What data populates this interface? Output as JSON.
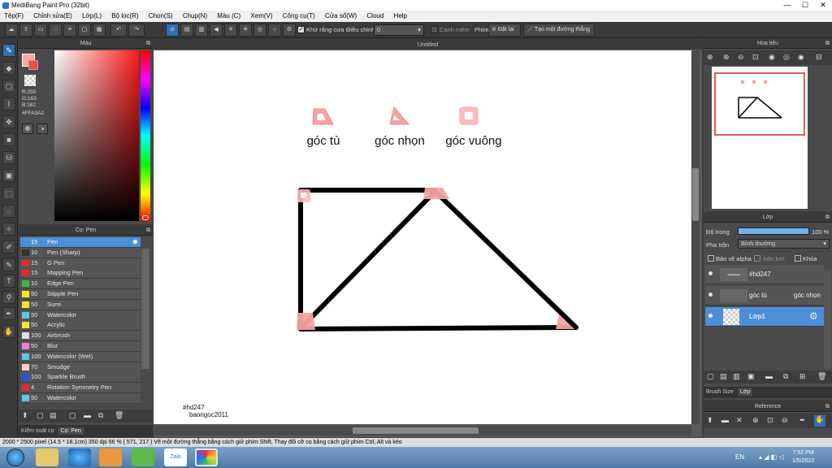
{
  "window": {
    "title": "MediBang Paint Pro (32bit)",
    "min": "—",
    "max": "☐",
    "close": "✕"
  },
  "menu": [
    "Tệp(F)",
    "Chỉnh sửa(E)",
    "Lớp(L)",
    "Bộ lọc(R)",
    "Chọn(S)",
    "Chụp(N)",
    "Màu (C)",
    "Xem(V)",
    "Công cụ(T)",
    "Cửa sổ(W)",
    "Cloud",
    "Help"
  ],
  "toolbar": {
    "antialias_label": "Khử răng cưa",
    "adjust_label": "Điều chỉnh",
    "adjust_value": "0",
    "sharp_label": "Cạnh mềm",
    "pen_label": "Phím",
    "reset_label": "Đặt lại",
    "create_line_label": "Tạo một đường thẳng"
  },
  "color_panel": {
    "title": "Màu",
    "r": "R:255",
    "g": "G:163",
    "b": "B:162",
    "hex": "#FFA3A2",
    "fg_color": "#ffa3a2"
  },
  "brush_panel": {
    "title": "Cọ: Pen",
    "items": [
      {
        "size": "15",
        "name": "Pen",
        "color": "#4a8fd8"
      },
      {
        "size": "10",
        "name": "Pen (Sharp)",
        "color": "#333333"
      },
      {
        "size": "15",
        "name": "G Pen",
        "color": "#e52b2b"
      },
      {
        "size": "15",
        "name": "Mapping Pen",
        "color": "#e52b2b"
      },
      {
        "size": "10",
        "name": "Edge Pen",
        "color": "#3cb83c"
      },
      {
        "size": "50",
        "name": "Stipple Pen",
        "color": "#f2e52b"
      },
      {
        "size": "50",
        "name": "Sumi",
        "color": "#f2e52b"
      },
      {
        "size": "50",
        "name": "Watercolor",
        "color": "#5bc8e8"
      },
      {
        "size": "50",
        "name": "Acrylic",
        "color": "#f2e52b"
      },
      {
        "size": "100",
        "name": "Airbrush",
        "color": "#dddddd"
      },
      {
        "size": "50",
        "name": "Blur",
        "color": "#f07ad7"
      },
      {
        "size": "100",
        "name": "Watercolor (Wet)",
        "color": "#5bc8e8"
      },
      {
        "size": "70",
        "name": "Smudge",
        "color": "#f5d6c0"
      },
      {
        "size": "100",
        "name": "Sparkle Brush",
        "color": "#2b4fe5"
      },
      {
        "size": "4",
        "name": "Rotation Symmetry Pen",
        "color": "#e52b2b"
      },
      {
        "size": "50",
        "name": "Watercolor",
        "color": "#5bc8e8"
      }
    ],
    "tab_control": "Kiểm soát cọ",
    "tab_pen": "Cọ: Pen"
  },
  "canvas": {
    "tab_title": "Untitled",
    "labels": [
      "góc tù",
      "góc nhọn",
      "góc vuông"
    ],
    "signature_1": "#hd247",
    "signature_2": "baongoc2011"
  },
  "navigator": {
    "title": "Hoa tiêu"
  },
  "layer_panel": {
    "title": "Lớp",
    "opacity_label": "Độ trong",
    "opacity_value": "100 %",
    "opacity": 1.0,
    "blend_label": "Pha trộn",
    "blend_value": "Bình thường",
    "protect_alpha": "Bảo vệ alpha",
    "clipping": "Xén bớt",
    "lock": "Khóa",
    "layers": [
      {
        "name": "#hd247",
        "extra": ""
      },
      {
        "name": "góc tù",
        "extra": "góc nhọn"
      },
      {
        "name": "Lớp1",
        "extra": ""
      }
    ],
    "tab_brush_size": "Brush Size",
    "tab_layer": "Lớp"
  },
  "reference": {
    "title": "Reference"
  },
  "status": {
    "text": "2000 * 2500 pixel   (14.5 * 18.1cm)   350 dpi   66 %   ( 571, 217 )   Vẽ một đường thẳng bằng cách giữ phím Shift, Thay đổi cỡ cọ bằng cách giữ phím Ctrl, Alt và kéo"
  },
  "taskbar": {
    "lang": "EN",
    "time": "7:52 PM",
    "date": "1/5/2022"
  }
}
